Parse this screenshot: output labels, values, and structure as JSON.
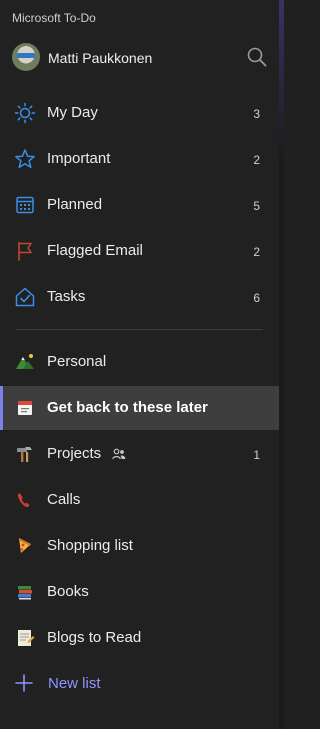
{
  "app": {
    "title": "Microsoft To-Do"
  },
  "user": {
    "name": "Matti Paukkonen"
  },
  "smart_lists": [
    {
      "label": "My Day",
      "count": "3",
      "icon": "sun-icon"
    },
    {
      "label": "Important",
      "count": "2",
      "icon": "star-icon"
    },
    {
      "label": "Planned",
      "count": "5",
      "icon": "calendar-icon"
    },
    {
      "label": "Flagged Email",
      "count": "2",
      "icon": "flag-icon"
    },
    {
      "label": "Tasks",
      "count": "6",
      "icon": "home-check-icon"
    }
  ],
  "lists": [
    {
      "label": "Personal",
      "count": "",
      "icon": "mountain-emoji-icon"
    },
    {
      "label": "Get back to these later",
      "count": "",
      "icon": "calendar-emoji-icon",
      "active": true
    },
    {
      "label": "Projects",
      "count": "1",
      "icon": "hammer-emoji-icon",
      "shared": true
    },
    {
      "label": "Calls",
      "count": "",
      "icon": "phone-emoji-icon"
    },
    {
      "label": "Shopping list",
      "count": "",
      "icon": "pizza-emoji-icon"
    },
    {
      "label": "Books",
      "count": "",
      "icon": "books-emoji-icon"
    },
    {
      "label": "Blogs to Read",
      "count": "",
      "icon": "memo-emoji-icon"
    }
  ],
  "new_list": {
    "label": "New list"
  },
  "colors": {
    "accent": "#7b83eb",
    "new_list_text": "#8f96ff",
    "smart_icon_blue": "#3b8eea",
    "flag_red": "#c4462e"
  }
}
